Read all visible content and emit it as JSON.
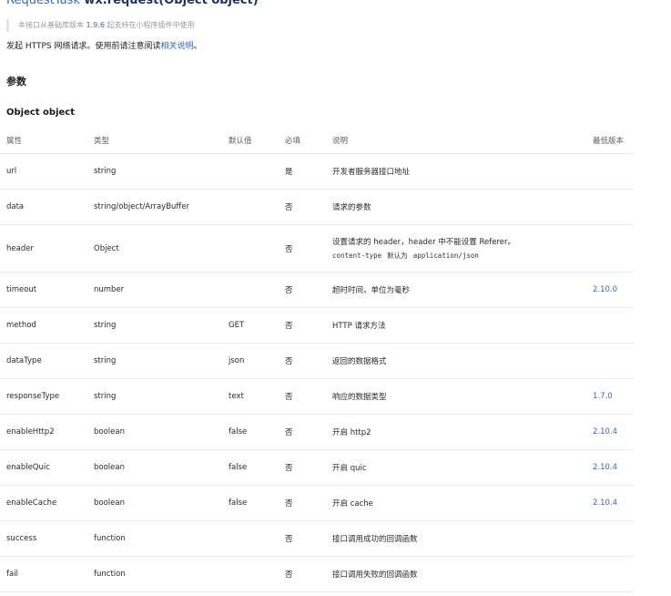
{
  "api": {
    "return_type": "RequestTask",
    "signature": "wx.request(Object object)"
  },
  "version_note": {
    "prefix": "本接口从基础库版本",
    "version": "1.9.6",
    "suffix": "起支持在小程序插件中使用"
  },
  "description": {
    "text": "发起 HTTPS 网络请求。使用前请注意阅读",
    "link": "相关说明",
    "end": "。"
  },
  "section_title": "参数",
  "object_title": "Object object",
  "table": {
    "headers": {
      "name": "属性",
      "type": "类型",
      "default": "默认值",
      "required": "必填",
      "desc": "说明",
      "version": "最低版本"
    },
    "rows": [
      {
        "name": "url",
        "type": "string",
        "default": "",
        "required": "是",
        "desc": "开发者服务器接口地址",
        "version": ""
      },
      {
        "name": "data",
        "type": "string/object/ArrayBuffer",
        "default": "",
        "required": "否",
        "desc": "请求的参数",
        "version": ""
      },
      {
        "name": "header",
        "type": "Object",
        "default": "",
        "required": "否",
        "desc": "设置请求的 header，header 中不能设置 Referer。",
        "desc_code_1": "content-type",
        "desc_code_text": "默认为",
        "desc_code_2": "application/json",
        "version": ""
      },
      {
        "name": "timeout",
        "type": "number",
        "default": "",
        "required": "否",
        "desc": "超时时间，单位为毫秒",
        "version": "2.10.0"
      },
      {
        "name": "method",
        "type": "string",
        "default": "GET",
        "required": "否",
        "desc": "HTTP 请求方法",
        "version": ""
      },
      {
        "name": "dataType",
        "type": "string",
        "default": "json",
        "required": "否",
        "desc": "返回的数据格式",
        "version": ""
      },
      {
        "name": "responseType",
        "type": "string",
        "default": "text",
        "required": "否",
        "desc": "响应的数据类型",
        "version": "1.7.0"
      },
      {
        "name": "enableHttp2",
        "type": "boolean",
        "default": "false",
        "required": "否",
        "desc": "开启 http2",
        "version": "2.10.4"
      },
      {
        "name": "enableQuic",
        "type": "boolean",
        "default": "false",
        "required": "否",
        "desc": "开启 quic",
        "version": "2.10.4"
      },
      {
        "name": "enableCache",
        "type": "boolean",
        "default": "false",
        "required": "否",
        "desc": "开启 cache",
        "version": "2.10.4"
      },
      {
        "name": "success",
        "type": "function",
        "default": "",
        "required": "否",
        "desc": "接口调用成功的回调函数",
        "version": ""
      },
      {
        "name": "fail",
        "type": "function",
        "default": "",
        "required": "否",
        "desc": "接口调用失败的回调函数",
        "version": ""
      }
    ]
  }
}
